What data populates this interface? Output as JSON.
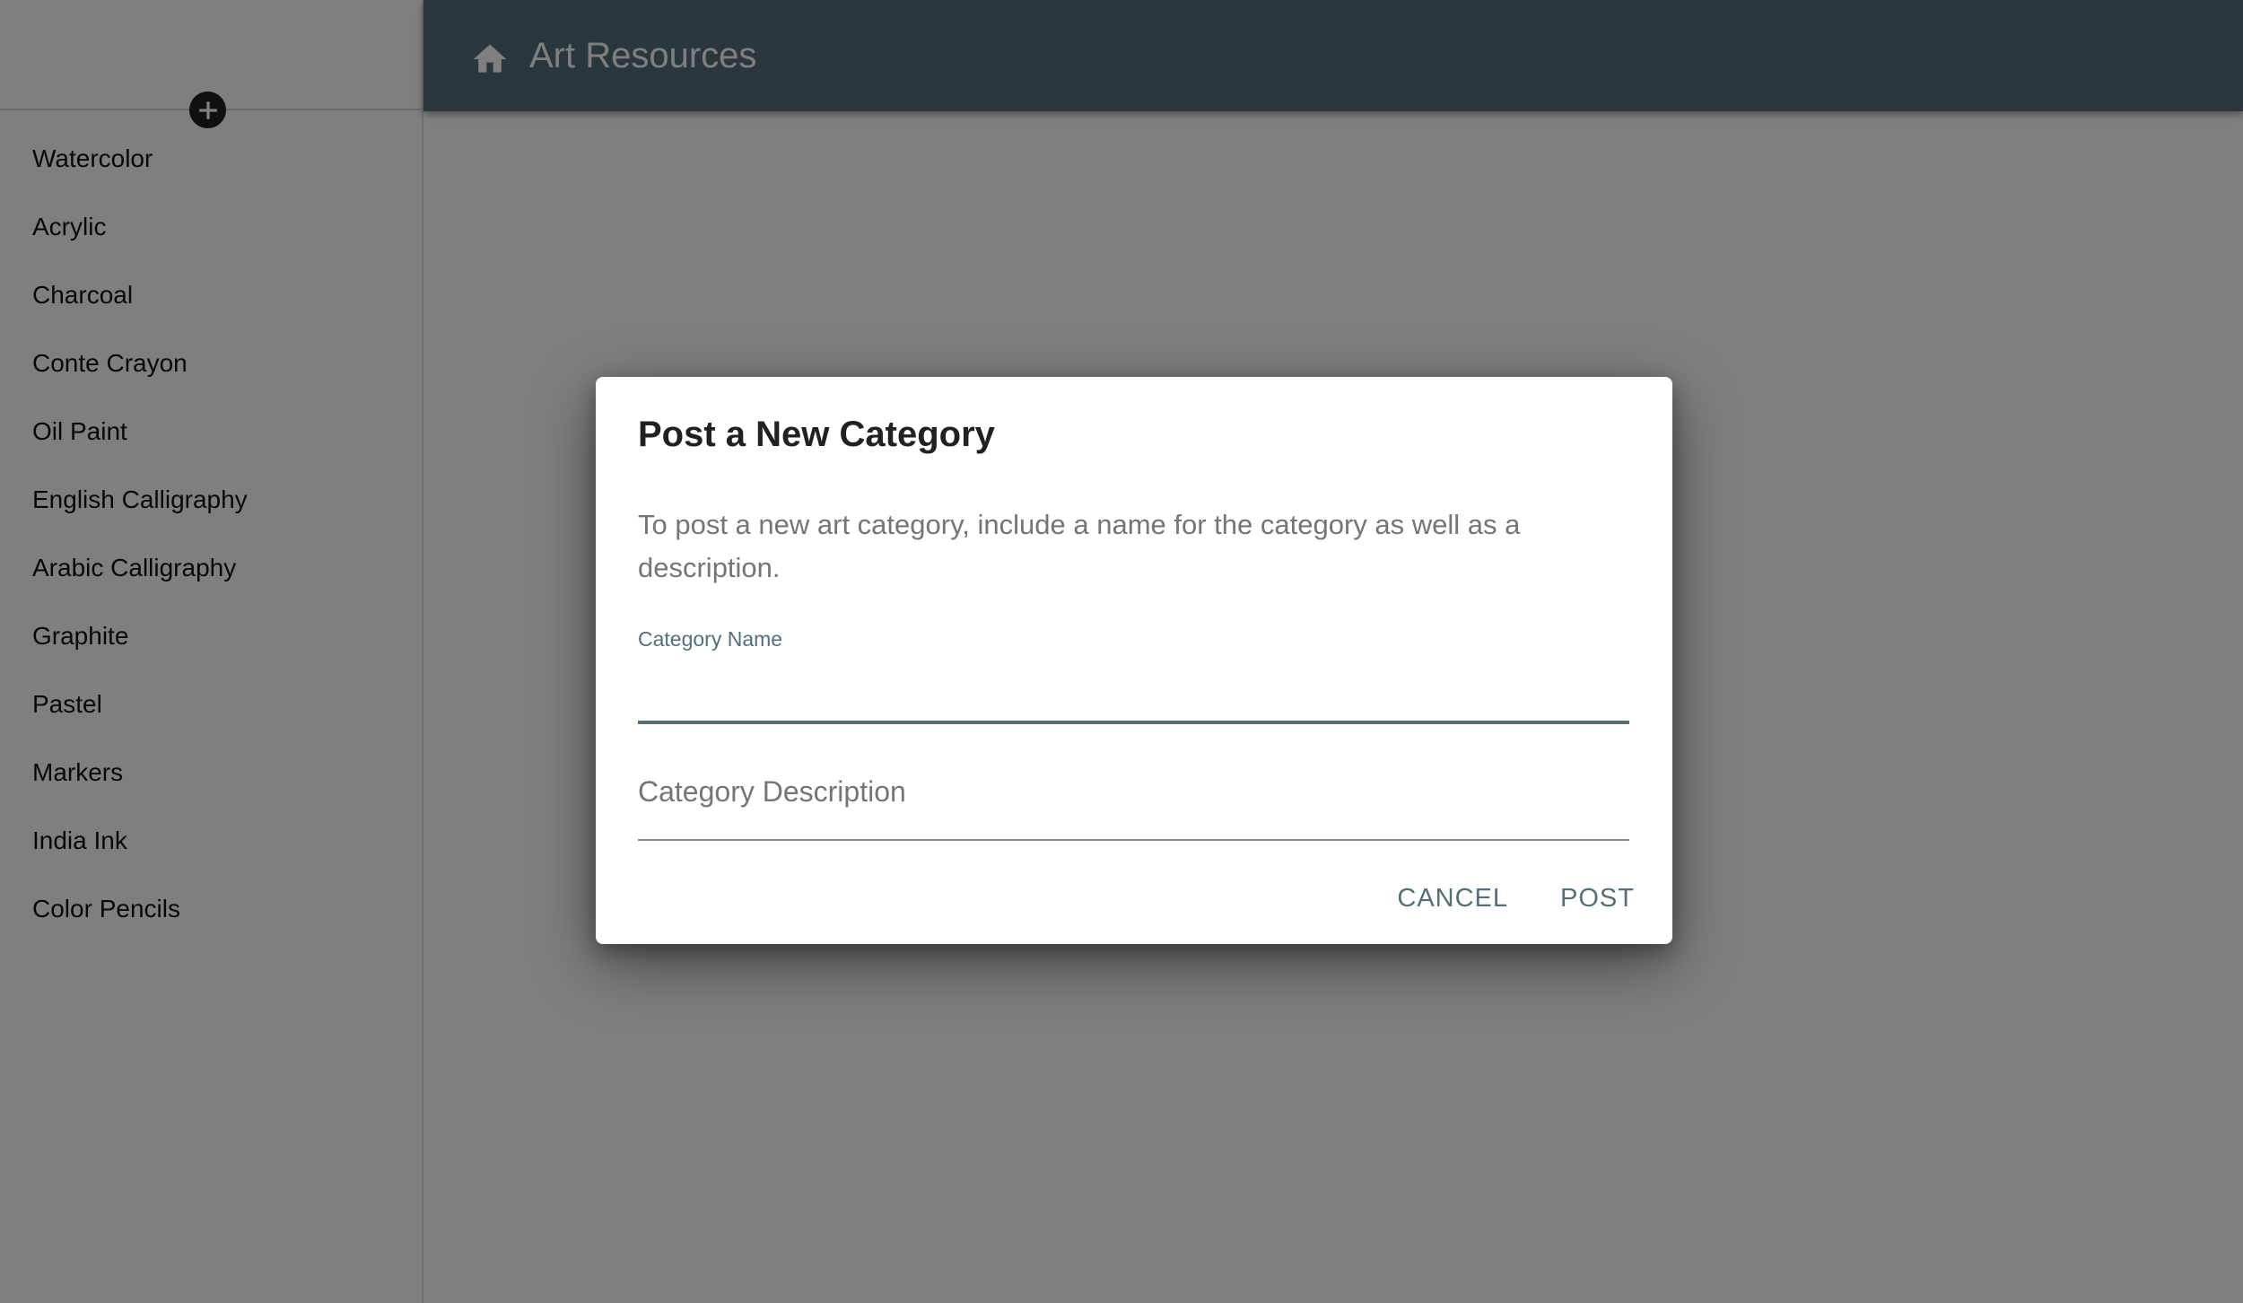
{
  "app": {
    "title": "Art Resources"
  },
  "sidebar": {
    "items": [
      {
        "label": "Watercolor"
      },
      {
        "label": "Acrylic"
      },
      {
        "label": "Charcoal"
      },
      {
        "label": "Conte Crayon"
      },
      {
        "label": "Oil Paint"
      },
      {
        "label": "English Calligraphy"
      },
      {
        "label": "Arabic Calligraphy"
      },
      {
        "label": "Graphite"
      },
      {
        "label": "Pastel"
      },
      {
        "label": "Markers"
      },
      {
        "label": "India Ink"
      },
      {
        "label": "Color Pencils"
      }
    ]
  },
  "dialog": {
    "title": "Post a New Category",
    "text": "To post a new art category, include a name for the category as well as a description.",
    "name_field": {
      "label": "Category Name",
      "value": ""
    },
    "description_field": {
      "placeholder": "Category Description",
      "value": ""
    },
    "cancel_label": "CANCEL",
    "post_label": "POST"
  },
  "colors": {
    "topbar": "#546e7a",
    "accent": "#546e7a",
    "overlay": "rgba(0,0,0,0.5)"
  },
  "icons": {
    "add": "plus-circle-icon",
    "home": "home-icon"
  }
}
